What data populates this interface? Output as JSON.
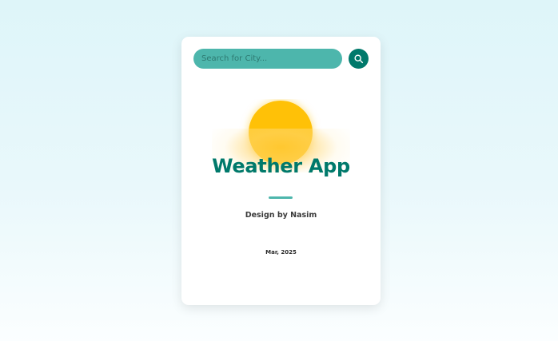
{
  "search": {
    "placeholder": "Search for City...",
    "value": "",
    "button_icon": "search-icon"
  },
  "hero": {
    "icon": "sun-icon",
    "title": "Weather App",
    "subtitle": "Design by Nasim",
    "date": "Mar, 2025"
  },
  "colors": {
    "page_background": "#def5f9",
    "card_background": "#ffffff",
    "search_field": "#4db6ac",
    "search_button": "#00796b",
    "title": "#00796b",
    "divider": "#4db6ac",
    "sun": "#ffc107"
  }
}
